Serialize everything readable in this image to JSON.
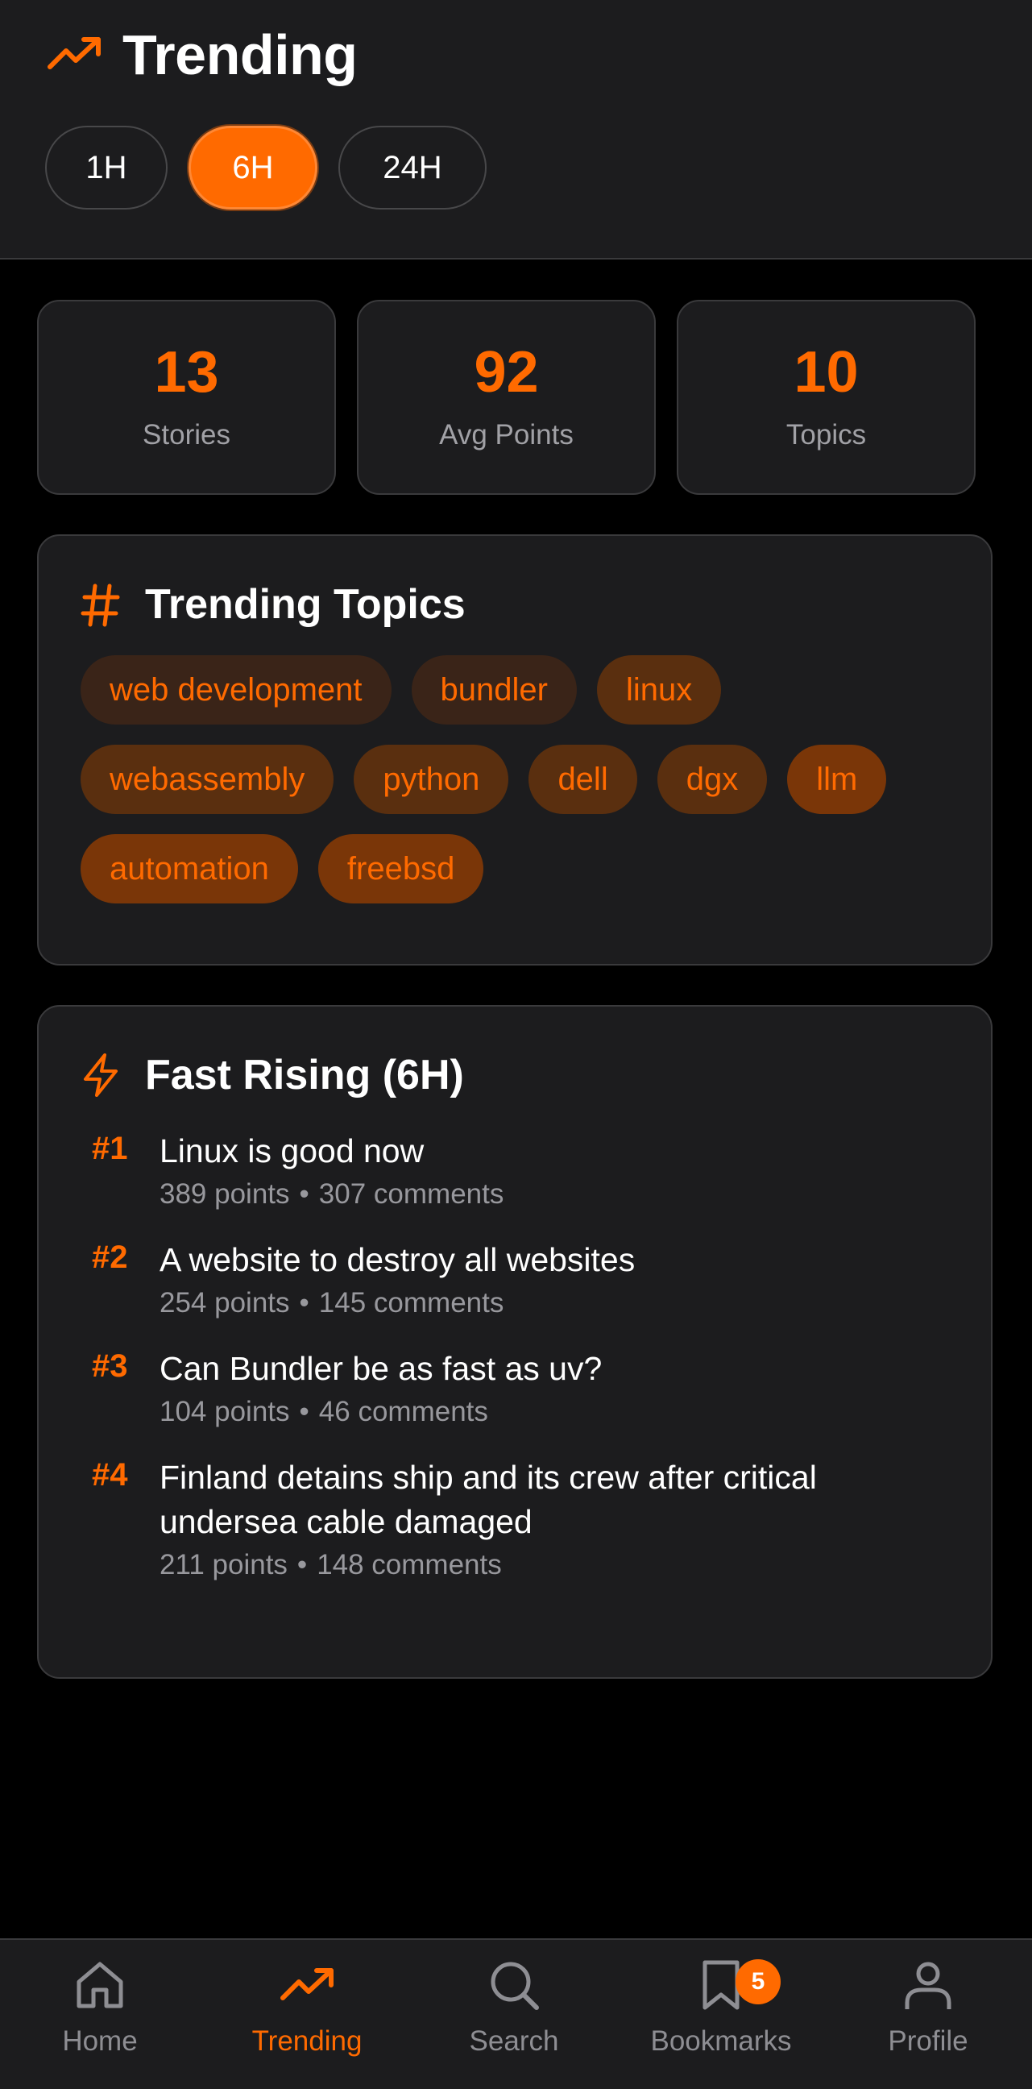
{
  "header": {
    "title": "Trending",
    "ranges": [
      "1H",
      "6H",
      "24H"
    ],
    "active_range": "6H"
  },
  "stats": [
    {
      "value": "13",
      "label": "Stories"
    },
    {
      "value": "92",
      "label": "Avg Points"
    },
    {
      "value": "10",
      "label": "Topics"
    }
  ],
  "topics": {
    "title": "Trending Topics",
    "chips": [
      "web development",
      "bundler",
      "linux",
      "webassembly",
      "python",
      "dell",
      "dgx",
      "llm",
      "automation",
      "freebsd"
    ]
  },
  "rising": {
    "title": "Fast Rising (6H)",
    "stories": [
      {
        "rank": "#1",
        "title": "Linux is good now",
        "points": "389 points",
        "comments": "307 comments"
      },
      {
        "rank": "#2",
        "title": "A website to destroy all websites",
        "points": "254 points",
        "comments": "145 comments"
      },
      {
        "rank": "#3",
        "title": "Can Bundler be as fast as uv?",
        "points": "104 points",
        "comments": "46 comments"
      },
      {
        "rank": "#4",
        "title": "Finland detains ship and its crew after critical undersea cable damaged",
        "points": "211 points",
        "comments": "148 comments"
      }
    ]
  },
  "tabbar": {
    "tabs": [
      {
        "label": "Home",
        "icon": "home-icon"
      },
      {
        "label": "Trending",
        "icon": "trending-icon"
      },
      {
        "label": "Search",
        "icon": "search-icon"
      },
      {
        "label": "Bookmarks",
        "icon": "bookmark-icon"
      },
      {
        "label": "Profile",
        "icon": "profile-icon"
      }
    ],
    "active": "Trending",
    "bookmarks_badge": "5"
  },
  "colors": {
    "accent": "#ff6a00",
    "background": "#000000",
    "card": "#1c1c1e"
  }
}
